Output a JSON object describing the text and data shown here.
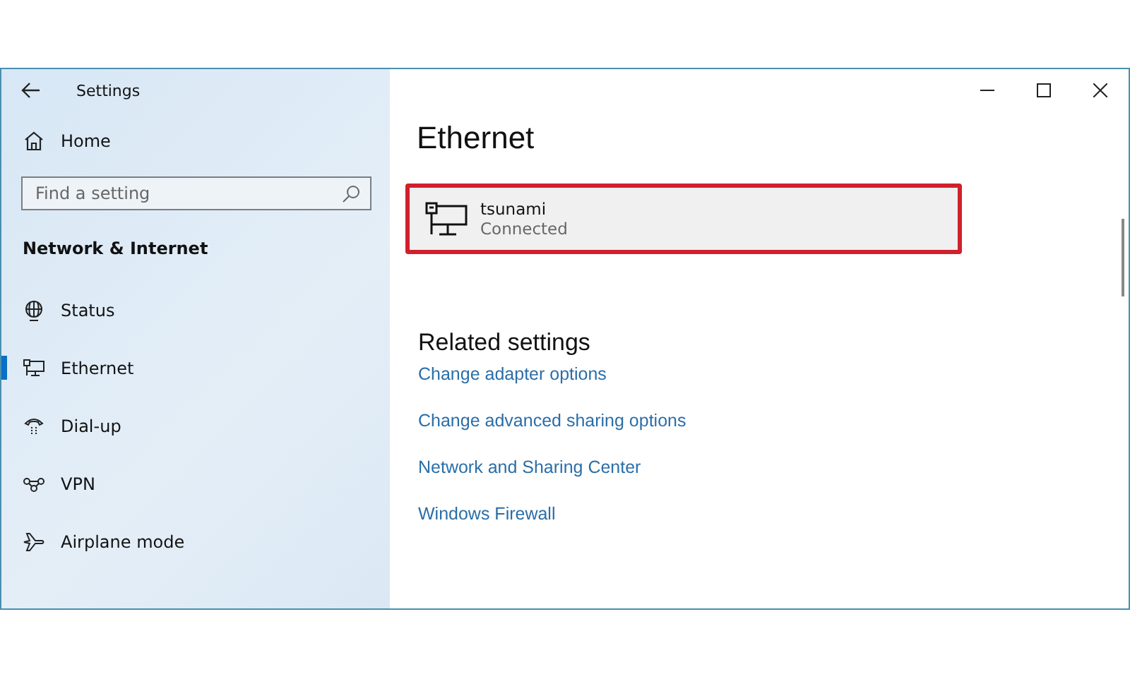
{
  "window": {
    "title": "Settings"
  },
  "sidebar": {
    "home": "Home",
    "search": {
      "placeholder": "Find a setting"
    },
    "section": "Network & Internet",
    "items": [
      {
        "label": "Status",
        "kind": "status",
        "selected": false
      },
      {
        "label": "Ethernet",
        "kind": "ethernet",
        "selected": true
      },
      {
        "label": "Dial-up",
        "kind": "dialup",
        "selected": false
      },
      {
        "label": "VPN",
        "kind": "vpn",
        "selected": false
      },
      {
        "label": "Airplane mode",
        "kind": "airplane",
        "selected": false
      }
    ]
  },
  "main": {
    "title": "Ethernet",
    "connection": {
      "name": "tsunami",
      "status": "Connected",
      "highlighted": true
    },
    "related_heading": "Related settings",
    "links": [
      "Change adapter options",
      "Change advanced sharing options",
      "Network and Sharing Center",
      "Windows Firewall"
    ]
  }
}
